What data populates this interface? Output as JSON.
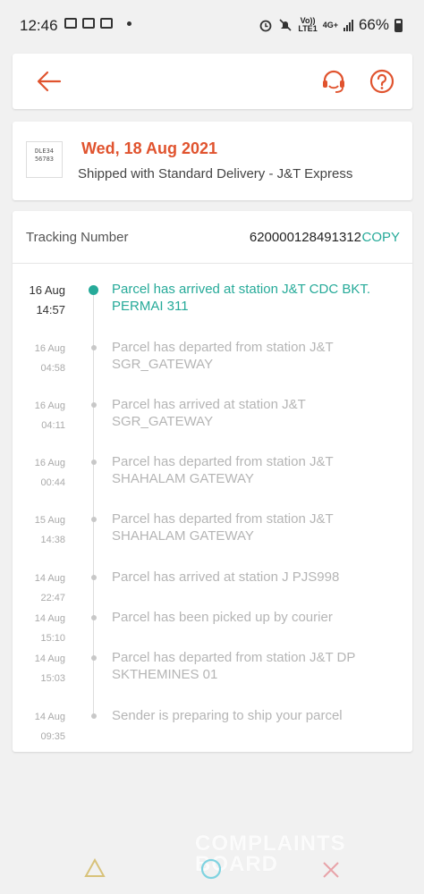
{
  "status_bar": {
    "time": "12:46",
    "network_top": "Vo))",
    "network_bottom": "LTE1",
    "net_type": "4G+",
    "battery": "66%"
  },
  "header": {
    "back_icon": "arrow-left-icon",
    "support_icon": "headset-icon",
    "help_icon": "question-circle-icon",
    "accent_color": "#e0532e"
  },
  "delivery": {
    "date": "Wed, 18 Aug 2021",
    "description": "Shipped with Standard Delivery  - J&T Express",
    "thumb_text": "DLE34 56783"
  },
  "tracking": {
    "label": "Tracking Number",
    "number": "620000128491312",
    "copy_label": "COPY",
    "events": [
      {
        "date": "16 Aug",
        "time": "14:57",
        "text": "Parcel has arrived at station J&T CDC BKT. PERMAI 311"
      },
      {
        "date": "16 Aug",
        "time": "04:58",
        "text": "Parcel has departed from station J&T SGR_GATEWAY"
      },
      {
        "date": "16 Aug",
        "time": "04:11",
        "text": "Parcel has arrived at station J&T SGR_GATEWAY"
      },
      {
        "date": "16 Aug",
        "time": "00:44",
        "text": "Parcel has departed from station J&T SHAHALAM GATEWAY"
      },
      {
        "date": "15 Aug",
        "time": "14:38",
        "text": "Parcel has departed from station J&T SHAHALAM GATEWAY"
      },
      {
        "date": "14 Aug",
        "time": "22:47",
        "text": "Parcel has arrived at station J PJS998"
      },
      {
        "date": "14 Aug",
        "time": "15:10",
        "text": "Parcel has been picked up by courier"
      },
      {
        "date": "14 Aug",
        "time": "15:03",
        "text": "Parcel has departed from station J&T DP SKTHEMINES 01"
      },
      {
        "date": "14 Aug",
        "time": "09:35",
        "text": "Sender is preparing to ship your parcel"
      }
    ]
  },
  "watermark": {
    "line1": "COMPLAINTS",
    "line2": "BOARD"
  },
  "theme": {
    "current_color": "#26aa99",
    "muted_color": "#b5b5b5"
  }
}
